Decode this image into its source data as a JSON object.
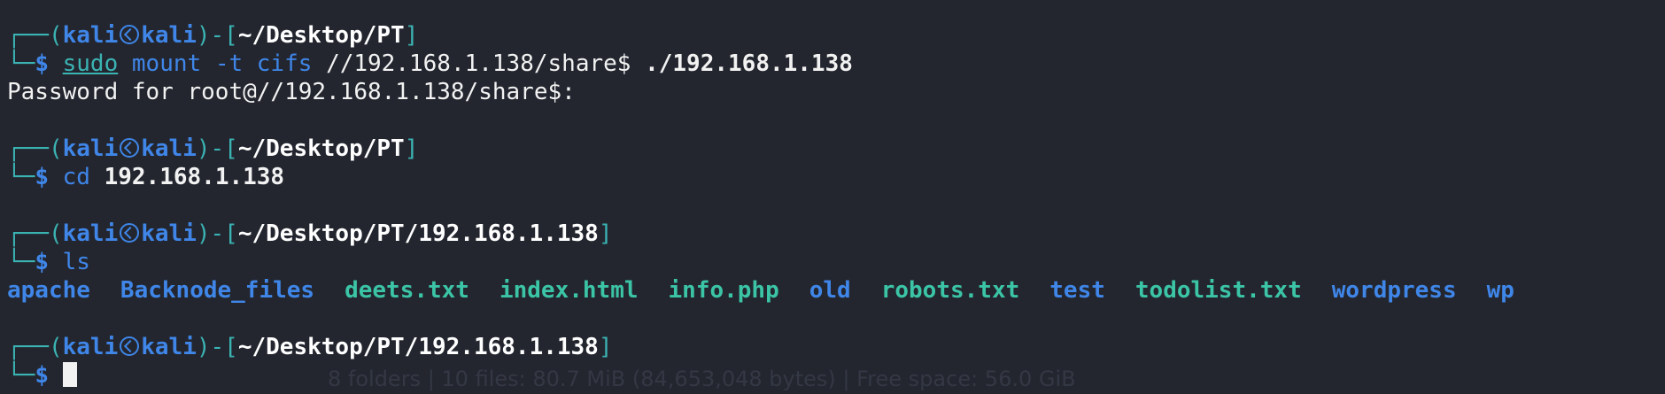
{
  "prompt": {
    "bracket_open": "┌──(",
    "user": "kali",
    "host": "kali",
    "mid": ")-[",
    "bracket_close": "]",
    "second_prefix": "└─",
    "dollar": "$"
  },
  "blocks": [
    {
      "path": "~/Desktop/PT",
      "cmd_sudo": "sudo",
      "cmd_rest": " mount -t cifs ",
      "cmd_arg1": "//192.168.1.138/share$",
      "cmd_arg2": " ./192.168.1.138",
      "output": "Password for root@//192.168.1.138/share$:"
    },
    {
      "path": "~/Desktop/PT",
      "cmd": "cd",
      "arg": " 192.168.1.138"
    },
    {
      "path": "~/Desktop/PT/192.168.1.138",
      "cmd": "ls"
    },
    {
      "path": "~/Desktop/PT/192.168.1.138"
    }
  ],
  "ls_output": [
    {
      "name": "apache",
      "kind": "dir"
    },
    {
      "name": "Backnode_files",
      "kind": "dir"
    },
    {
      "name": "deets.txt",
      "kind": "file"
    },
    {
      "name": "index.html",
      "kind": "file"
    },
    {
      "name": "info.php",
      "kind": "file"
    },
    {
      "name": "old",
      "kind": "dir"
    },
    {
      "name": "robots.txt",
      "kind": "file"
    },
    {
      "name": "test",
      "kind": "dir"
    },
    {
      "name": "todolist.txt",
      "kind": "file"
    },
    {
      "name": "wordpress",
      "kind": "dir"
    },
    {
      "name": "wp",
      "kind": "dir"
    }
  ],
  "status_bar": "8 folders | 10 files: 80.7 MiB (84,653,048 bytes) | Free space: 56.0 GiB",
  "colors": {
    "background": "#23262f",
    "cyan": "#3bb3b3",
    "blue": "#3f86e8",
    "file_teal": "#3bc4a6"
  }
}
